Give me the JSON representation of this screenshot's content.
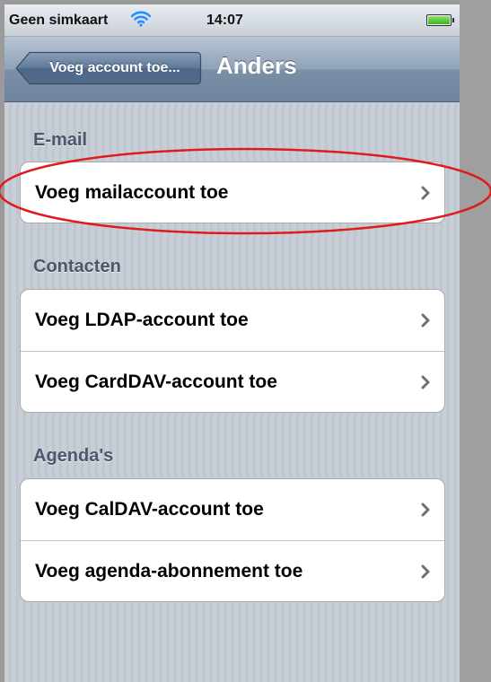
{
  "status_bar": {
    "carrier": "Geen simkaart",
    "time": "14:07",
    "wifi_icon": "wifi-icon",
    "battery_icon": "battery-icon",
    "battery_level": 1.0
  },
  "nav": {
    "back_label": "Voeg account toe...",
    "title": "Anders"
  },
  "sections": [
    {
      "header": "E-mail",
      "rows": [
        {
          "label": "Voeg mailaccount toe"
        }
      ]
    },
    {
      "header": "Contacten",
      "rows": [
        {
          "label": "Voeg LDAP-account toe"
        },
        {
          "label": "Voeg CardDAV-account toe"
        }
      ]
    },
    {
      "header": "Agenda's",
      "rows": [
        {
          "label": "Voeg CalDAV-account toe"
        },
        {
          "label": "Voeg agenda-abonnement toe"
        }
      ]
    }
  ],
  "colors": {
    "annotation": "#e01b1b",
    "section_header": "#4c566c",
    "navbar": "#7b90a8"
  }
}
